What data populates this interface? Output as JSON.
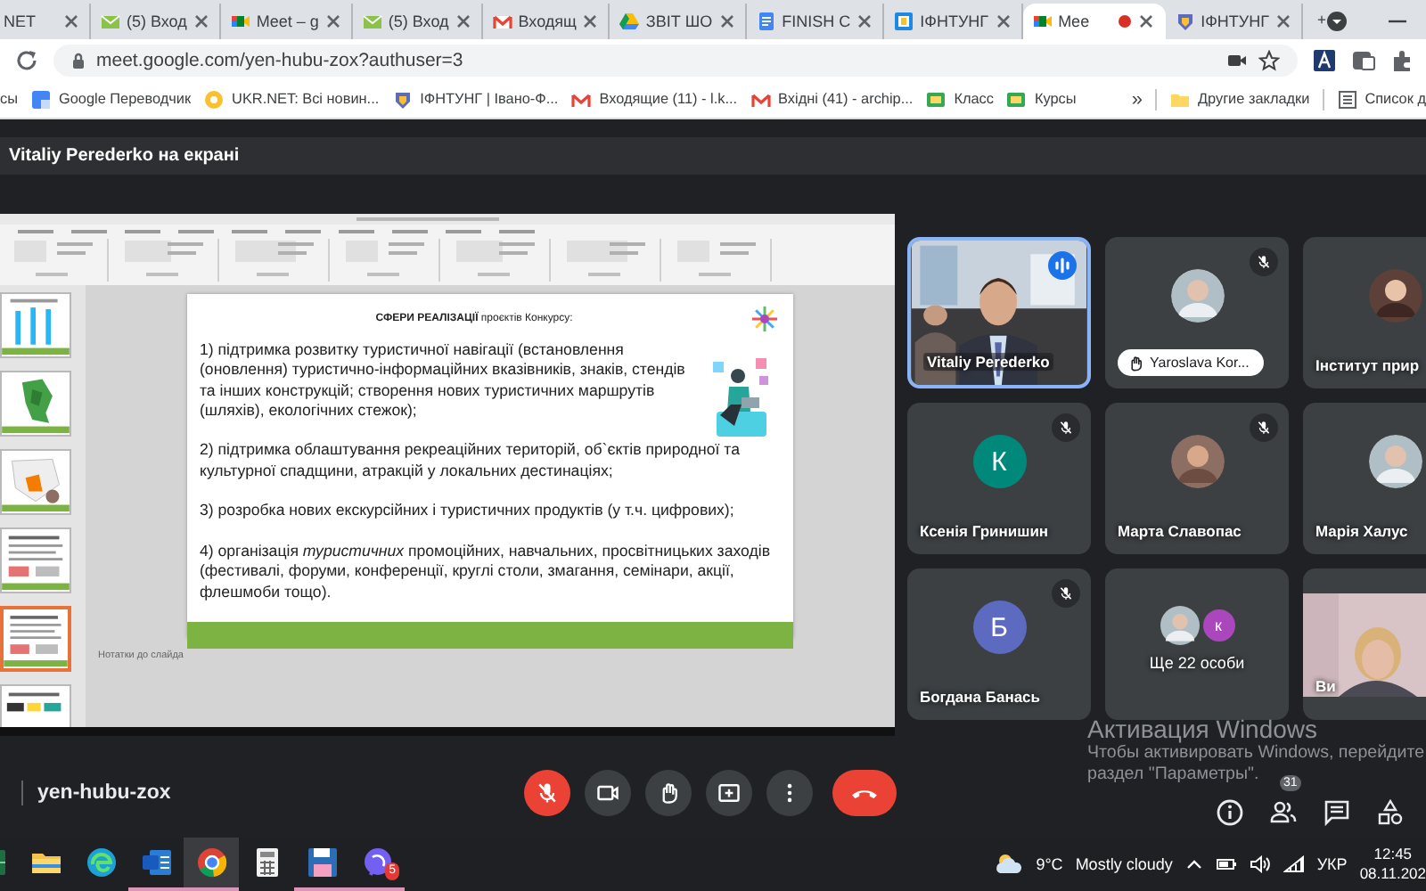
{
  "browser": {
    "tabs": [
      {
        "title": "NET",
        "kind": "none",
        "selected": false,
        "recording": false
      },
      {
        "title": "(5) Вход",
        "kind": "mail",
        "selected": false,
        "recording": false
      },
      {
        "title": "Meet – g",
        "kind": "meet",
        "selected": false,
        "recording": false
      },
      {
        "title": "(5) Вход",
        "kind": "mail",
        "selected": false,
        "recording": false
      },
      {
        "title": "Входящ",
        "kind": "gmail",
        "selected": false,
        "recording": false
      },
      {
        "title": "ЗВІТ ШО",
        "kind": "drive",
        "selected": false,
        "recording": false
      },
      {
        "title": "FINISH С",
        "kind": "docs",
        "selected": false,
        "recording": false
      },
      {
        "title": "ІФНТУНГ",
        "kind": "classroom",
        "selected": false,
        "recording": false
      },
      {
        "title": "Mee",
        "kind": "meet",
        "selected": true,
        "recording": true
      },
      {
        "title": "ІФНТУНГ",
        "kind": "crest",
        "selected": false,
        "recording": false
      }
    ],
    "address": "meet.google.com/yen-hubu-zox?authuser=3",
    "bookmarks": [
      {
        "label": "сы",
        "kind": "none"
      },
      {
        "label": "Google Переводчик",
        "kind": "translate"
      },
      {
        "label": "UKR.NET: Всі новин...",
        "kind": "ukrnet"
      },
      {
        "label": "ІФНТУНГ | Івано-Ф...",
        "kind": "crest"
      },
      {
        "label": "Входящие (11) - l.k...",
        "kind": "gmail"
      },
      {
        "label": "Вхідні (41) - archip...",
        "kind": "gmail"
      },
      {
        "label": "Класс",
        "kind": "course"
      },
      {
        "label": "Курсы",
        "kind": "course"
      }
    ],
    "bookmarks_more": "»",
    "bookmark_folders": [
      {
        "label": "Другие закладки",
        "kind": "folder"
      },
      {
        "label": "Список д",
        "kind": "list"
      }
    ]
  },
  "meet": {
    "presenter_banner": "Vitaliy Perederko на екрані",
    "presentation": {
      "thumbnails": [
        {
          "kind": "chart",
          "selected": false
        },
        {
          "kind": "map",
          "selected": false
        },
        {
          "kind": "map-orange",
          "selected": false
        },
        {
          "kind": "text",
          "selected": false
        },
        {
          "kind": "text",
          "selected": true
        },
        {
          "kind": "logos",
          "selected": false
        }
      ],
      "slide": {
        "title": "**СФЕРИ РЕАЛІЗАЦІЇ** проєктів Конкурсу:",
        "items": [
          "1) підтримка розвитку туристичної навігації (встановлення (оновлення) туристично-інформаційних вказівників, знаків, стендів та інших конструкцій; створення нових туристичних маршрутів (шляхів), екологічних стежок);",
          "2) підтримка облаштування рекреаційних територій, об`єктів природної та культурної спадщини, атракцій у локальних дестинаціях;",
          "3) розробка нових екскурсійних і туристичних продуктів (у т.ч. цифрових);",
          "4) організація *туристичних* промоційних, навчальних, просвітницьких заходів (фестивалі, форуми, конференції, круглі столи, змагання, семінари, акції, флешмоби тощо)."
        ]
      },
      "notes_placeholder": "Нотатки до слайда"
    },
    "tiles": [
      {
        "kind": "video",
        "name": "Vitaliy Perederko",
        "muted": false,
        "speaking": true,
        "hand_raised": false
      },
      {
        "name": "Yaroslava Kor...",
        "muted": true,
        "speaking": false,
        "hand_raised": true
      },
      {
        "name": "Інститут прир",
        "muted": false,
        "speaking": false,
        "hand_raised": false
      },
      {
        "kind": "letter",
        "letter": "К",
        "color": "#00897b",
        "name": "Ксенія Гринишин",
        "muted": true,
        "speaking": false,
        "hand_raised": false
      },
      {
        "name": "Марта Славопас",
        "muted": true,
        "speaking": false,
        "hand_raised": false
      },
      {
        "name": "Марія Халус",
        "muted": false,
        "speaking": false,
        "hand_raised": false
      },
      {
        "kind": "letter",
        "letter": "Б",
        "color": "#5c6bc0",
        "name": "Богдана Банась",
        "muted": true,
        "speaking": false,
        "hand_raised": false
      },
      {
        "kind": "more",
        "letter": "к",
        "color": "#ab47bc",
        "name": "Ще 22 особи",
        "muted": false,
        "speaking": false,
        "hand_raised": false
      },
      {
        "kind": "self_video",
        "name": "Ви",
        "muted": false,
        "speaking": false,
        "hand_raised": false
      }
    ],
    "meeting_code": "yen-hubu-zox",
    "controls": [
      {
        "kind": "mic",
        "on": false
      },
      {
        "kind": "camera",
        "on": true
      },
      {
        "kind": "hand"
      },
      {
        "kind": "present"
      },
      {
        "kind": "more"
      },
      {
        "kind": "leave"
      }
    ],
    "side_buttons": [
      {
        "kind": "info"
      },
      {
        "kind": "people",
        "badge": "31"
      },
      {
        "kind": "chat"
      },
      {
        "kind": "activities"
      }
    ]
  },
  "windows_notice": {
    "title": "Активация Windows",
    "lines": [
      "Чтобы активировать Windows, перейдите",
      "раздел \"Параметры\"."
    ]
  },
  "taskbar": {
    "apps": [
      {
        "kind": "spreadsheet",
        "active": false,
        "running": false
      },
      {
        "kind": "folder",
        "active": false,
        "running": false
      },
      {
        "kind": "edge",
        "active": false,
        "running": false
      },
      {
        "kind": "word",
        "active": false,
        "running": true
      },
      {
        "kind": "chrome",
        "active": true,
        "running": true
      },
      {
        "kind": "calculator",
        "active": false,
        "running": false
      },
      {
        "kind": "floppy",
        "active": false,
        "running": true
      },
      {
        "kind": "viber",
        "active": false,
        "running": true,
        "badge": "5"
      }
    ],
    "weather": {
      "temp": "9°C",
      "condition": "Mostly cloudy"
    },
    "language": "УКР",
    "time": "12:45",
    "date": "08.11.202"
  }
}
